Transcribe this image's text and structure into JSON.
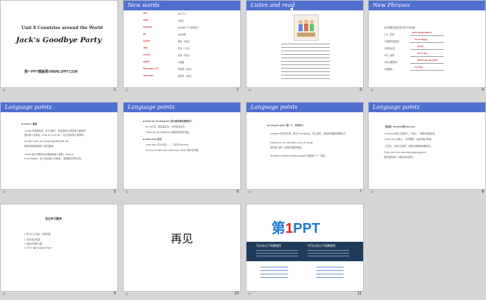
{
  "slides": [
    {
      "num": "1",
      "title": "Unit 8  Countries around the World",
      "subtitle": "Jack's Goodbye Party",
      "site": "第一PPT模板网-WWW.1PPT.COM"
    },
    {
      "num": "2",
      "title": "New words",
      "words": [
        "door",
        "invite",
        "everyone",
        "fair",
        "Sydney",
        "Jake",
        "London",
        "capital",
        "Washington D.C.",
        "Vancouver"
      ],
      "defs": [
        "adv.门  n.",
        "v.邀请",
        "pron.每个人;所有的人",
        "adj.晴朗",
        "悉尼（地名）",
        "杰克（人名）",
        "伦敦（地名）",
        "n.首都",
        "华盛顿（地名）",
        "温哥华（地名）"
      ]
    },
    {
      "num": "3",
      "title": "Listen and read"
    },
    {
      "num": "4",
      "title": "New Phrases",
      "heading": "请你根据汉语意思完成下列短语",
      "lines": [
        "1.为...告别",
        "2.感谢你的邀请",
        "3.参加比赛",
        "4.在...找到",
        "5.你从哪里来？",
        "6.美国的...."
      ],
      "answers": [
        "Jack's going back to ...",
        "I'm so happy...",
        "Great!",
        "He is very...",
        "Where are you from?",
        "I'm from..."
      ]
    },
    {
      "num": "5",
      "title": "Language points",
      "heading": "◆ invite v. 邀请",
      "lines": [
        "①invite 作及物动词，意为“邀请”，常用结构为“邀请某人做某事”",
        "邀请某人去某处。Invite sb. to do sth.；意为“邀请某人做某事”",
        "He didn't invite me to play basketball with him.",
        "他没有邀请我和他一起打篮球。",
        "②invite 表示可数的名词是邀请某人某物，Invite sb",
        "to someplace，意为“邀请某人去某地”，强调两件事的关系。"
      ]
    },
    {
      "num": "6",
      "title": "Language points",
      "lines": [
        "◆ thank sb. for doing sth. 因为做某事而感谢某人",
        "for 为介词，其后接名词，代词或动名词。",
        "Thank you for calling me. 谢谢你给我打电话。",
        "◆ come from 来自",
        "come from 意为“来自……”，相当于be from。",
        "He is from China.=He comes from China. 他来自中国。"
      ]
    },
    {
      "num": "7",
      "title": "Language points",
      "lines": [
        "◆ everyone pron. 每个人，所有的人",
        "everyone 作不定代词，相当于everybody，作主语时，谓语动词要用单数形式。",
        "Everyone in our class likes Cui's Lee songs.",
        "我们班上每个人都喜欢崔的歌曲。",
        "She gives everyone a piece of paper. 她给每个人一张纸。"
      ]
    },
    {
      "num": "8",
      "title": "Language points",
      "lines": [
        "【拓展】everyone和every one",
        "①everyone表示泛指的人，只指人，不跟of短语连用。",
        "②every one 可指人，也可指物，后面可接of短语。",
        "【注意】二者作主语时，谓语动词都用单数形式。",
        "Every one of our class likes playing games.",
        "我们班的每个人都喜欢玩游戏。"
      ]
    },
    {
      "num": "9",
      "heading": "自主学习要求",
      "lines": [
        "1.学习以上内容，认真阅读",
        "2. 熟记重点短语",
        "3. 课后完成练习题",
        "4. 学习一遍“Goodbye Party”"
      ]
    },
    {
      "num": "10",
      "text": "再见"
    },
    {
      "num": "11",
      "brand_prefix": "第",
      "brand_digit": "1",
      "brand_suffix": "PPT",
      "left_head": "可以在以下场景使用",
      "right_head": "不可以在以下场景使用"
    }
  ],
  "colors": {
    "header": "#4f6fd1",
    "title_red": "#c00000",
    "brand_blue": "#1a7bd4",
    "brand_red": "#e02020",
    "dark_band": "#1f3b5a"
  },
  "icons": {
    "footer": "star-icon"
  }
}
